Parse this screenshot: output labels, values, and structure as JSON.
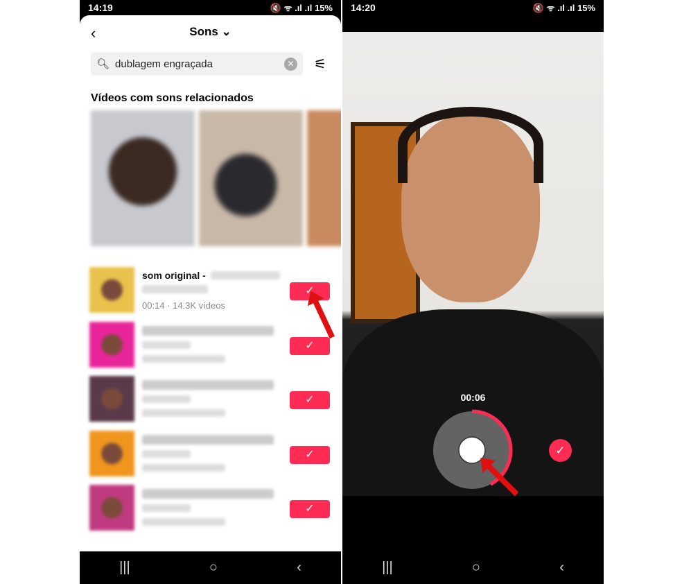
{
  "left": {
    "status": {
      "time": "14:19",
      "icons": "▣ ▮ ◎ •",
      "right": "🔇 ᯤ .ıl .ıl 15%"
    },
    "header": {
      "title": "Sons ⌄",
      "back": "‹"
    },
    "search": {
      "value": "dublagem engraçada",
      "clear": "✕",
      "filter": "⚟"
    },
    "section_title": "Vídeos com sons relacionados",
    "sounds": [
      {
        "title": "som original - ",
        "meta": "00:14 · 14.3K vídeos",
        "thumb": "#e8c24a"
      },
      {
        "thumb": "#e9259a"
      },
      {
        "thumb": "#5a3a4a"
      },
      {
        "thumb": "#f0961e"
      },
      {
        "thumb": "#c03a80"
      }
    ],
    "check": "✓"
  },
  "right": {
    "status": {
      "time": "14:20",
      "icons": "▣ ▮ ◎ •",
      "right": "🔇 ᯤ .ıl .ıl 15%"
    },
    "timer": "00:06",
    "record_progress": 0.42,
    "confirm": "✓"
  },
  "nav": {
    "recent": "|||",
    "home": "○",
    "back": "‹"
  },
  "colors": {
    "accent": "#fe2c55",
    "annotation_arrow": "#e01010"
  }
}
